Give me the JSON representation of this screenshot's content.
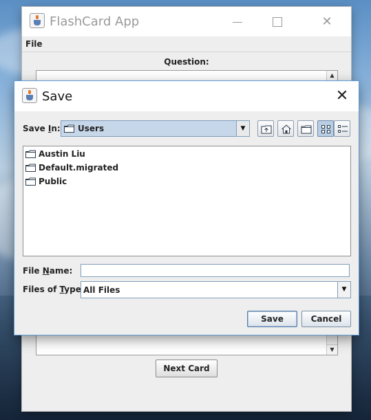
{
  "main_window": {
    "title": "FlashCard App",
    "menu": {
      "file": "File"
    },
    "question_label": "Question:",
    "next_button": "Next Card",
    "controls": {
      "minimize": "—",
      "maximize": "☐",
      "close": "✕"
    }
  },
  "dialog": {
    "title": "Save",
    "close_glyph": "✕",
    "save_in": {
      "label_prefix": "Save ",
      "label_mnemonic": "I",
      "label_suffix": "n:",
      "value": "Users"
    },
    "toolbar": [
      "up-one-level-icon",
      "home-icon",
      "new-folder-icon",
      "list-view-icon",
      "details-view-icon"
    ],
    "files": [
      "Austin Liu",
      "Default.migrated",
      "Public"
    ],
    "file_name": {
      "label_prefix": "File ",
      "label_mnemonic": "N",
      "label_suffix": "ame:",
      "value": ""
    },
    "files_of_type": {
      "label_prefix": "Files of ",
      "label_mnemonic": "T",
      "label_suffix": "ype:",
      "value": "All Files"
    },
    "buttons": {
      "save": "Save",
      "cancel": "Cancel"
    }
  },
  "colors": {
    "accent": "#5e9bd2",
    "selection": "#c7d7ea",
    "window_bg": "#eeeeee"
  }
}
